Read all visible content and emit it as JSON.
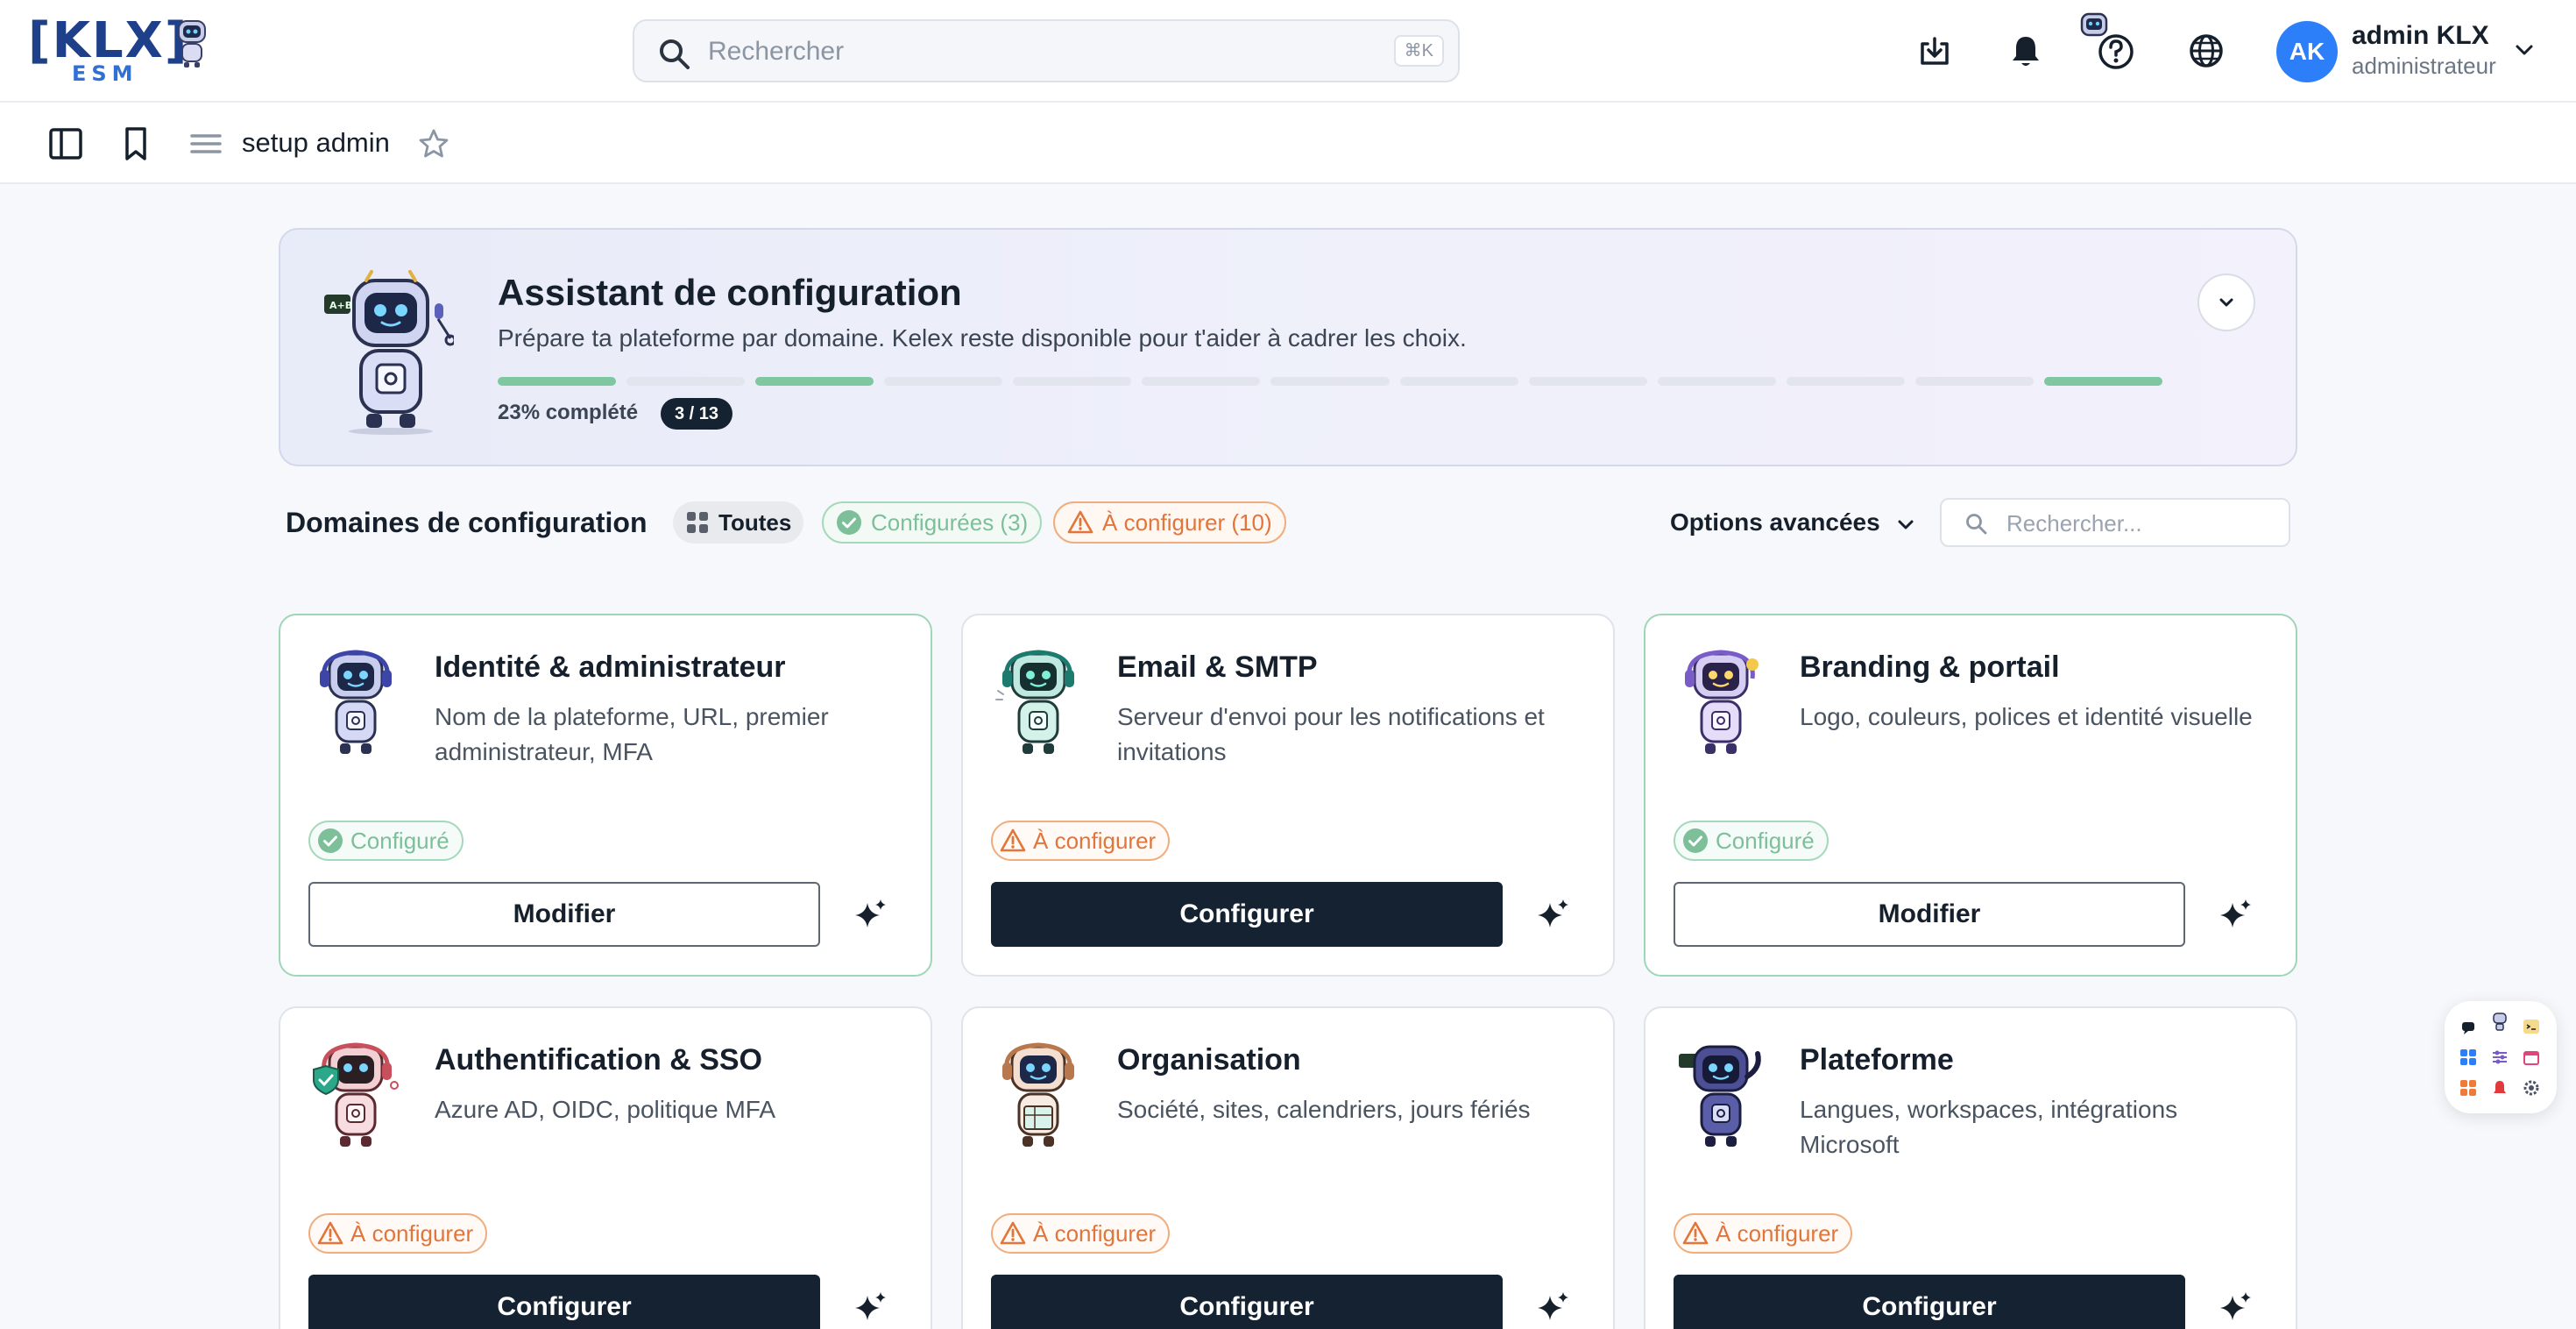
{
  "header": {
    "logo": {
      "brand": "[KLX]",
      "sub": "ESM"
    },
    "search": {
      "placeholder": "Rechercher",
      "shortcut": "⌘K"
    },
    "icons": [
      "download-icon",
      "bell-icon",
      "help-icon",
      "globe-icon"
    ],
    "user": {
      "initials": "AK",
      "name": "admin KLX",
      "role": "administrateur"
    }
  },
  "subbar": {
    "breadcrumb": "setup admin"
  },
  "wizard": {
    "title": "Assistant de configuration",
    "subtitle": "Prépare ta plateforme par domaine. Kelex reste disponible pour t'aider à cadrer les choix.",
    "progress_label": "23% complété",
    "count_label": "3 / 13",
    "progress_fraction": 0.23,
    "steps": [
      true,
      false,
      true,
      false,
      false,
      false,
      false,
      false,
      false,
      false,
      false,
      false,
      true
    ]
  },
  "filters": {
    "section_title": "Domaines de configuration",
    "all": "Toutes",
    "configured": "Configurées (3)",
    "todo": "À configurer (10)",
    "advanced": "Options avancées",
    "search_placeholder": "Rechercher..."
  },
  "cards": [
    {
      "title": "Identité & administrateur",
      "desc": "Nom de la plateforme, URL, premier administrateur, MFA",
      "status": "Configuré",
      "button": "Modifier"
    },
    {
      "title": "Email & SMTP",
      "desc": "Serveur d'envoi pour les notifications et invitations",
      "status": "À configurer",
      "button": "Configurer"
    },
    {
      "title": "Branding & portail",
      "desc": "Logo, couleurs, polices et identité visuelle",
      "status": "Configuré",
      "button": "Modifier"
    },
    {
      "title": "Authentification & SSO",
      "desc": "Azure AD, OIDC, politique MFA",
      "status": "À configurer",
      "button": "Configurer"
    },
    {
      "title": "Organisation",
      "desc": "Société, sites, calendriers, jours fériés",
      "status": "À configurer",
      "button": "Configurer"
    },
    {
      "title": "Plateforme",
      "desc": "Langues, workspaces, intégrations Microsoft",
      "status": "À configurer",
      "button": "Configurer"
    }
  ],
  "colors": {
    "accent": "#2d7ff9",
    "dark": "#142232",
    "success": "#7cbf99",
    "warning": "#e2753a",
    "progress": "#7fc7a1"
  }
}
